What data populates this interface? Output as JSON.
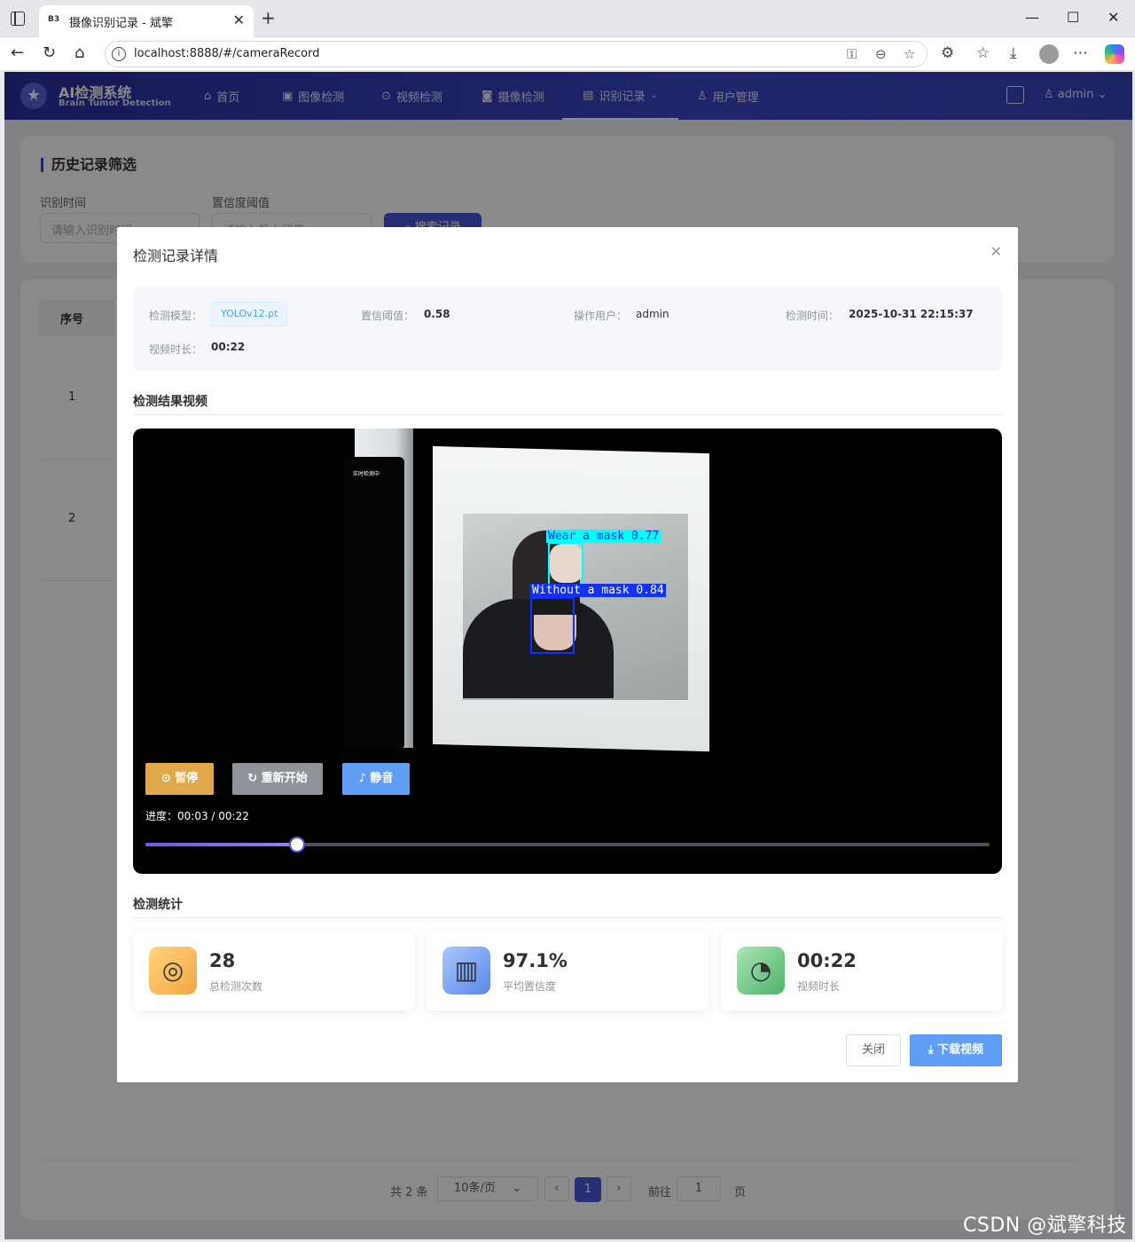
{
  "browser": {
    "tab_title": "摄像识别记录 - 斌擎",
    "favicon_text": "B3",
    "url": "localhost:8888/#/cameraRecord"
  },
  "header": {
    "logo_title": "AI检测系统",
    "logo_subtitle": "Brain Tumor Detection",
    "nav": [
      {
        "label": "首页",
        "icon": "home-icon"
      },
      {
        "label": "图像检测",
        "icon": "image-icon"
      },
      {
        "label": "视频检测",
        "icon": "play-icon"
      },
      {
        "label": "摄像检测",
        "icon": "camera-icon"
      },
      {
        "label": "识别记录",
        "icon": "document-icon",
        "active": true
      },
      {
        "label": "用户管理",
        "icon": "user-icon"
      }
    ],
    "user": "admin"
  },
  "filter": {
    "title": "历史记录筛选",
    "time_label": "识别时间",
    "time_placeholder": "请输入识别时间",
    "conf_label": "置信度阈值",
    "conf_placeholder": "请输入最小阈值",
    "search_label": "搜索记录"
  },
  "table": {
    "header_index": "序号",
    "rows": [
      "1",
      "2"
    ]
  },
  "pagination": {
    "total": "共 2 条",
    "page_size": "10条/页",
    "current": "1",
    "goto_label": "前往",
    "goto_value": "1",
    "page_unit": "页"
  },
  "dialog": {
    "title": "检测记录详情",
    "info": {
      "model_label": "检测模型：",
      "model_value": "YOLOv12.pt",
      "conf_label": "置信阈值：",
      "conf_value": "0.58",
      "user_label": "操作用户：",
      "user_value": "admin",
      "time_label": "检测时间：",
      "time_value": "2025-10-31 22:15:37",
      "duration_label": "视频时长：",
      "duration_value": "00:22"
    },
    "video_section_title": "检测结果视频",
    "video": {
      "phone_text": "实时检测中",
      "detections": [
        {
          "label": "Wear a mask 0.77",
          "color": "#00ffff"
        },
        {
          "label": "Without a mask 0.84",
          "color": "#1030ff"
        }
      ],
      "pause_label": "暂停",
      "restart_label": "重新开始",
      "mute_label": "静音",
      "progress_label": "进度：00:03 / 00:22",
      "progress_fraction": 0.18
    },
    "stats_section_title": "检测统计",
    "stats": [
      {
        "value": "28",
        "label": "总检测次数",
        "icon": "target-icon"
      },
      {
        "value": "97.1%",
        "label": "平均置信度",
        "icon": "bar-chart-icon"
      },
      {
        "value": "00:22",
        "label": "视频时长",
        "icon": "stopwatch-icon"
      }
    ],
    "close_label": "关闭",
    "download_label": "下载视频"
  },
  "watermark": "CSDN @斌擎科技",
  "colors": {
    "primary": "#3b46c5",
    "pause": "#e0a84b",
    "restart": "#909399",
    "mute": "#5f9df7"
  }
}
